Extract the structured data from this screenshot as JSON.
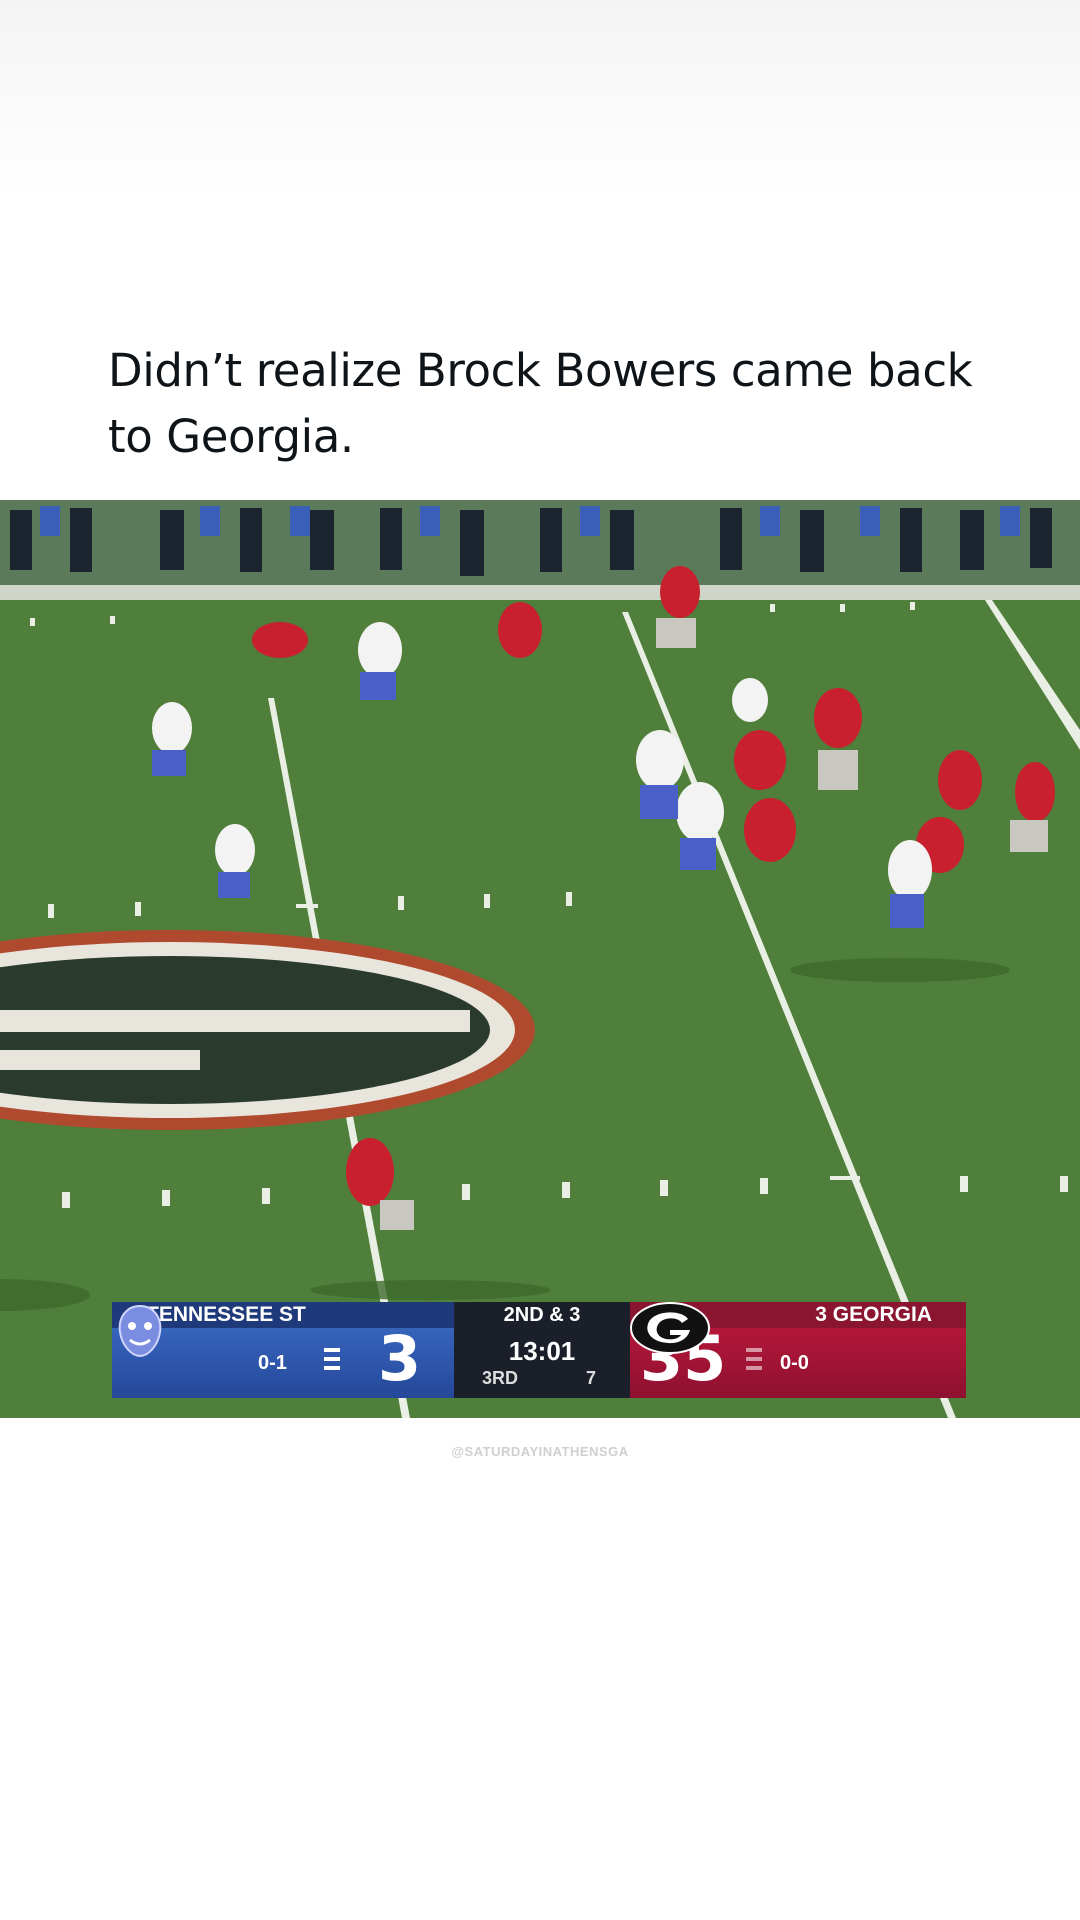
{
  "post": {
    "caption": "Didn’t realize Brock Bowers came back to Georgia."
  },
  "scoreboard": {
    "away_team": "TENNESSEE ST",
    "away_record": "0-1",
    "away_score": "3",
    "home_team": "3 GEORGIA",
    "home_record": "0-0",
    "home_score": "35",
    "down_distance": "2ND & 3",
    "clock": "13:01",
    "quarter": "3RD",
    "play_clock": "7",
    "away_color": "#2a55ad",
    "home_color": "#b3163a"
  },
  "watermark": "@SATURDAYINATHENSGA",
  "icons": {
    "away_logo": "tiger-logo-icon",
    "home_logo": "georgia-g-logo-icon"
  }
}
